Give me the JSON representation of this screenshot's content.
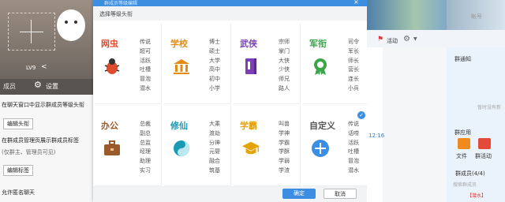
{
  "left": {
    "lv": "LV9",
    "tab_members": "成员",
    "settings": "设置",
    "opt1": "在聊天窗口中显示群成员等级头衔",
    "btn_edit_title": "编辑头衔",
    "opt2": "在群成员管理页展示群成员标签",
    "opt2_note": "(仅群主、管理员可见)",
    "btn_edit_tag": "编辑标签",
    "opt3": "允许匿名聊天"
  },
  "modal": {
    "title": "群成员等级编辑",
    "subtitle": "选择等级头衔",
    "ok": "确定",
    "cancel": "取消",
    "categories": [
      {
        "name": "网虫",
        "color": "#e04a2f",
        "icon": "bug-icon",
        "ranks": [
          "传说",
          "超可",
          "活跃",
          "吐槽",
          "冒泡",
          "潜水"
        ]
      },
      {
        "name": "学校",
        "color": "#e58a13",
        "icon": "school-icon",
        "ranks": [
          "博士",
          "硕士",
          "大学",
          "高中",
          "初中",
          "小学"
        ]
      },
      {
        "name": "武侠",
        "color": "#7b3fb7",
        "icon": "book-icon",
        "ranks": [
          "宗师",
          "掌门",
          "大侠",
          "少侠",
          "师兄",
          "路人"
        ]
      },
      {
        "name": "军衔",
        "color": "#3aa54a",
        "icon": "medal-icon",
        "ranks": [
          "司令",
          "军长",
          "师长",
          "营长",
          "连长",
          "小兵"
        ]
      },
      {
        "name": "办公",
        "color": "#9a5b2b",
        "icon": "briefcase-icon",
        "ranks": [
          "总裁",
          "副总",
          "总监",
          "经理",
          "助理",
          "实习"
        ]
      },
      {
        "name": "修仙",
        "color": "#199ab5",
        "icon": "taichi-icon",
        "ranks": [
          "大乘",
          "渡劫",
          "分神",
          "元婴",
          "融合",
          "筑基"
        ]
      },
      {
        "name": "学霸",
        "color": "#e5a30a",
        "icon": "graduation-cap-icon",
        "ranks": [
          "叫兽",
          "学神",
          "学霸",
          "学酥",
          "学弱",
          "学渣"
        ]
      },
      {
        "name": "自定义",
        "color": "#555555",
        "icon": "plus-icon",
        "ranks": [
          "传说",
          "话唠",
          "活跃",
          "吐槽",
          "冒泡",
          "潜水"
        ]
      }
    ]
  },
  "right": {
    "time": "12:16",
    "activity": "活动",
    "search": "帐号",
    "notice_title": "群通知",
    "notice_empty": "暂时没有新",
    "app_title": "群应用",
    "file": "文件",
    "group_activity": "群活动",
    "members": "群成员(4/4)",
    "search_members": "搜索群成员",
    "member_badge": "【潜水】"
  }
}
